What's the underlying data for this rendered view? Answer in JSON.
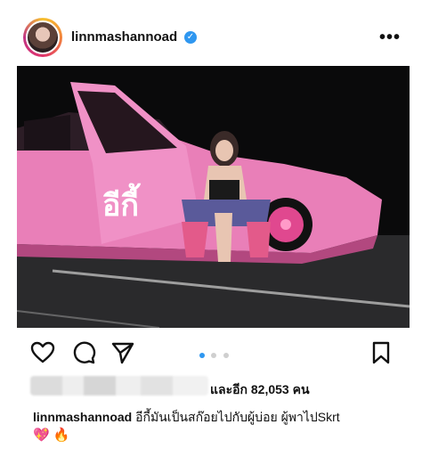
{
  "post": {
    "username": "linnmashannoad",
    "verified_icon": "verified-badge-icon",
    "more_label": "•••",
    "image_alt": "",
    "car_text": "อีกี้",
    "carousel": {
      "total": 3,
      "active": 1
    },
    "likes_text": "และอีก 82,053 คน",
    "caption_user": "linnmashannoad",
    "caption_text": "อีกี้มันเป็นสก๊อยไปกับผู้บ่อย ผู้พาไปSkrt",
    "caption_emojis": "💖 🔥"
  },
  "actions": {
    "like_icon": "heart-icon",
    "comment_icon": "comment-icon",
    "share_icon": "send-icon",
    "save_icon": "bookmark-icon"
  },
  "colors": {
    "accent": "#2f97f0",
    "car_pink": "#e66bb0"
  }
}
